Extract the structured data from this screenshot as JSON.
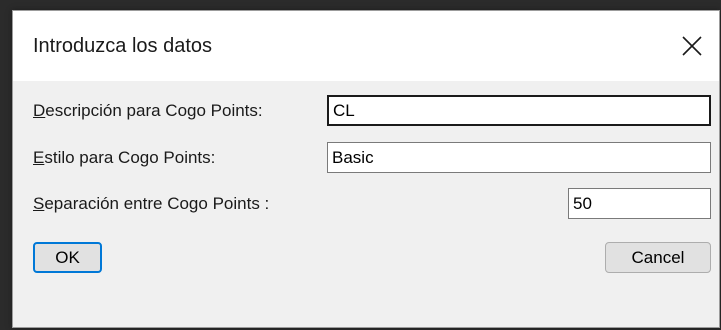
{
  "dialog": {
    "title": "Introduzca los datos",
    "fields": {
      "descripcion": {
        "label_accel": "D",
        "label_rest": "escripción para Cogo Points:",
        "value": "CL"
      },
      "estilo": {
        "label_accel": "E",
        "label_rest": "stilo para Cogo Points:",
        "value": "Basic"
      },
      "separacion": {
        "label_accel": "S",
        "label_rest": "eparación entre Cogo Points :",
        "value": "50"
      }
    },
    "buttons": {
      "ok": "OK",
      "cancel": "Cancel"
    }
  }
}
